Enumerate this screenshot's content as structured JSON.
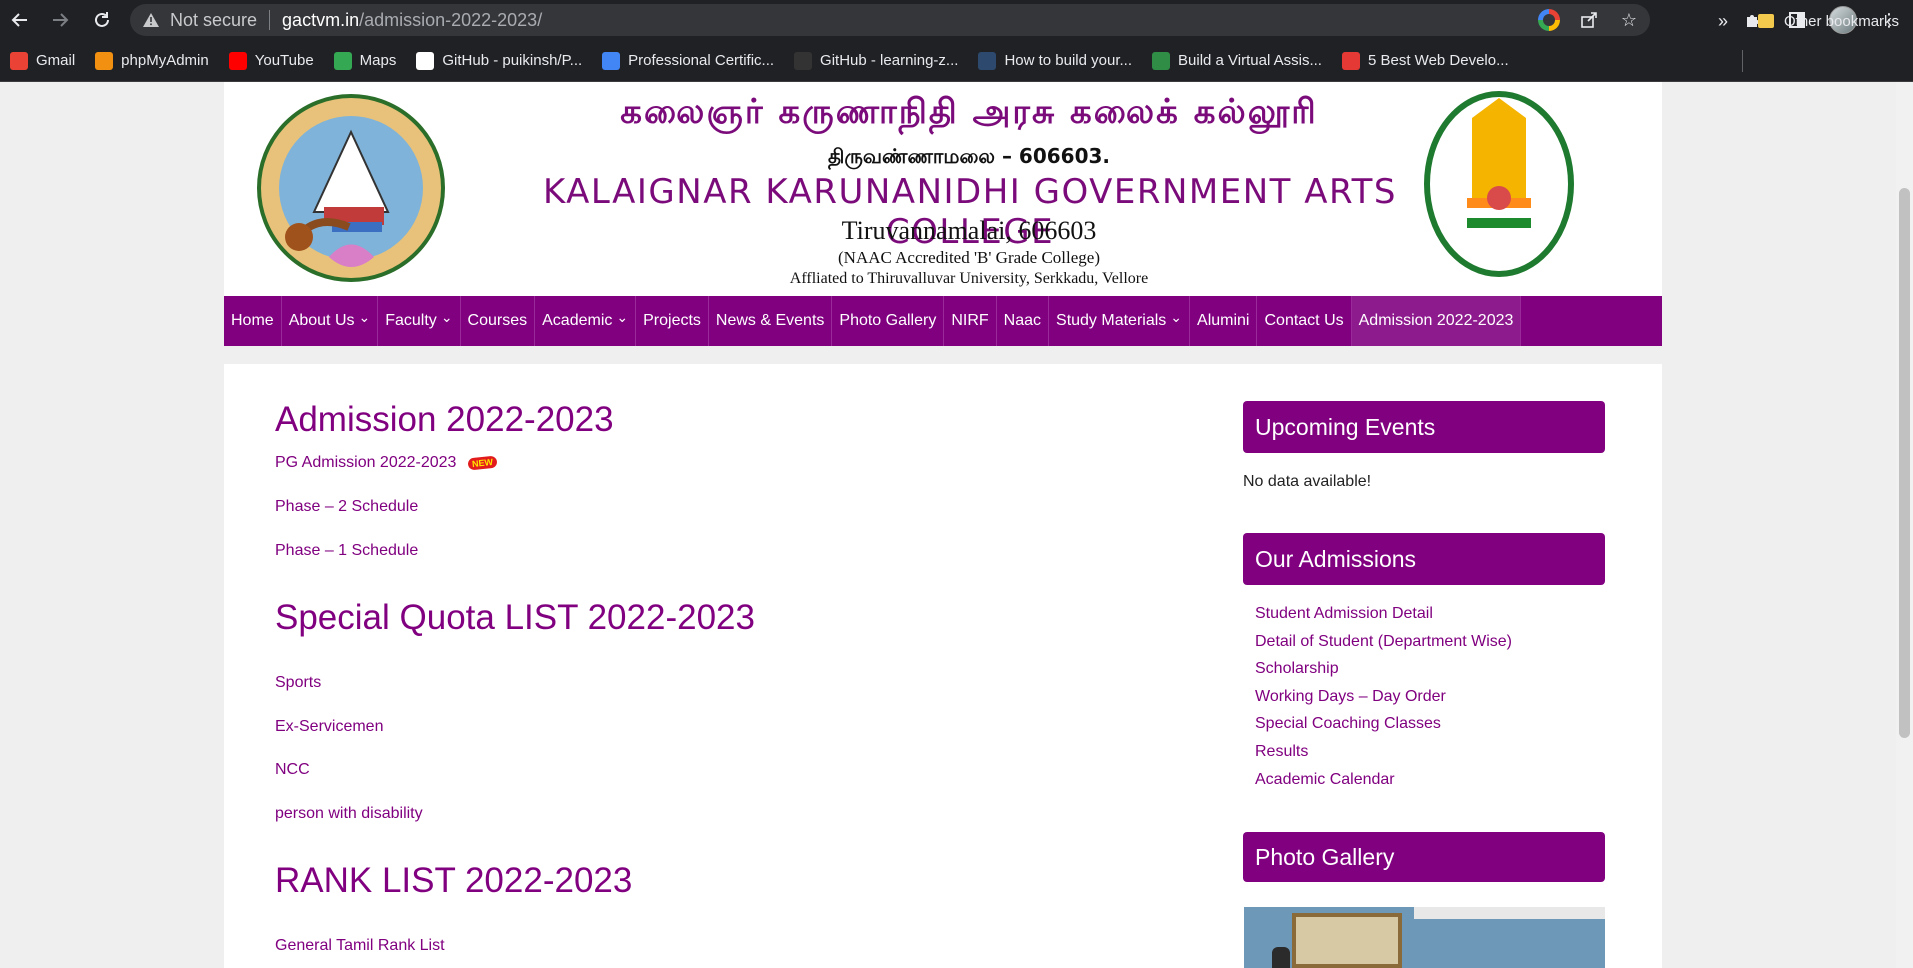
{
  "browser": {
    "not_secure": "Not secure",
    "url_host": "gactvm.in",
    "url_path": "/admission-2022-2023/",
    "bookmarks": [
      {
        "label": "Gmail",
        "icon": "gmail-icon",
        "color": "#ea4335"
      },
      {
        "label": "phpMyAdmin",
        "icon": "phpmyadmin-icon",
        "color": "#f29111"
      },
      {
        "label": "YouTube",
        "icon": "youtube-icon",
        "color": "#ff0000"
      },
      {
        "label": "Maps",
        "icon": "maps-icon",
        "color": "#34a853"
      },
      {
        "label": "GitHub - puikinsh/P...",
        "icon": "github-icon",
        "color": "#ffffff"
      },
      {
        "label": "Professional Certific...",
        "icon": "google-icon",
        "color": "#4285f4"
      },
      {
        "label": "GitHub - learning-z...",
        "icon": "github-icon",
        "color": "#333333"
      },
      {
        "label": "How to build your...",
        "icon": "tds-icon",
        "color": "#2d4a6e"
      },
      {
        "label": "Build a Virtual Assis...",
        "icon": "gfg-icon",
        "color": "#2f8d46"
      },
      {
        "label": "5 Best Web Develo...",
        "icon": "s-icon",
        "color": "#e53935"
      }
    ],
    "more": "»",
    "other_bookmarks": "Other bookmarks"
  },
  "header": {
    "tamil_title": "கலைஞர் கருணாநிதி அரசு கலைக் கல்லூரி",
    "tamil_sub": "திருவண்ணாமலை – 606603.",
    "college_name": "KALAIGNAR KARUNANIDHI GOVERNMENT ARTS COLLEGE",
    "city": "Tiruvannamalai, 606603",
    "naac": "(NAAC Accredited 'B' Grade College)",
    "affiliation": "Affliated to Thiruvalluvar University, Serkkadu, Vellore"
  },
  "nav": {
    "items": [
      {
        "label": "Home",
        "dropdown": false
      },
      {
        "label": "About Us",
        "dropdown": true
      },
      {
        "label": "Faculty",
        "dropdown": true
      },
      {
        "label": "Courses",
        "dropdown": false
      },
      {
        "label": "Academic",
        "dropdown": true
      },
      {
        "label": "Projects",
        "dropdown": false
      },
      {
        "label": "News & Events",
        "dropdown": false
      },
      {
        "label": "Photo Gallery",
        "dropdown": false
      },
      {
        "label": "NIRF",
        "dropdown": false
      },
      {
        "label": "Naac",
        "dropdown": false
      },
      {
        "label": "Study Materials",
        "dropdown": true
      },
      {
        "label": "Alumini",
        "dropdown": false
      },
      {
        "label": "Contact Us",
        "dropdown": false
      },
      {
        "label": "Admission 2022-2023",
        "dropdown": false
      }
    ]
  },
  "main": {
    "admission_title": "Admission 2022-2023",
    "pg_admission": "PG Admission 2022-2023",
    "new_badge": "NEW",
    "phase2": "Phase – 2 Schedule",
    "phase1": "Phase – 1 Schedule",
    "special_title": "Special Quota LIST 2022-2023",
    "special_links": [
      "Sports",
      "Ex-Servicemen",
      "NCC",
      "person with disability"
    ],
    "rank_title": "RANK LIST 2022-2023",
    "rank_links": [
      "General Tamil Rank List"
    ]
  },
  "sidebar": {
    "events_title": "Upcoming Events",
    "events_empty": "No data available!",
    "admissions_title": "Our Admissions",
    "admissions_links": [
      "Student Admission Detail",
      "Detail of Student (Department Wise)",
      "Scholarship",
      "Working Days – Day Order",
      "Special Coaching Classes",
      "Results",
      "Academic Calendar"
    ],
    "gallery_title": "Photo Gallery"
  },
  "colors": {
    "brand": "#800080",
    "chrome": "#202124"
  }
}
